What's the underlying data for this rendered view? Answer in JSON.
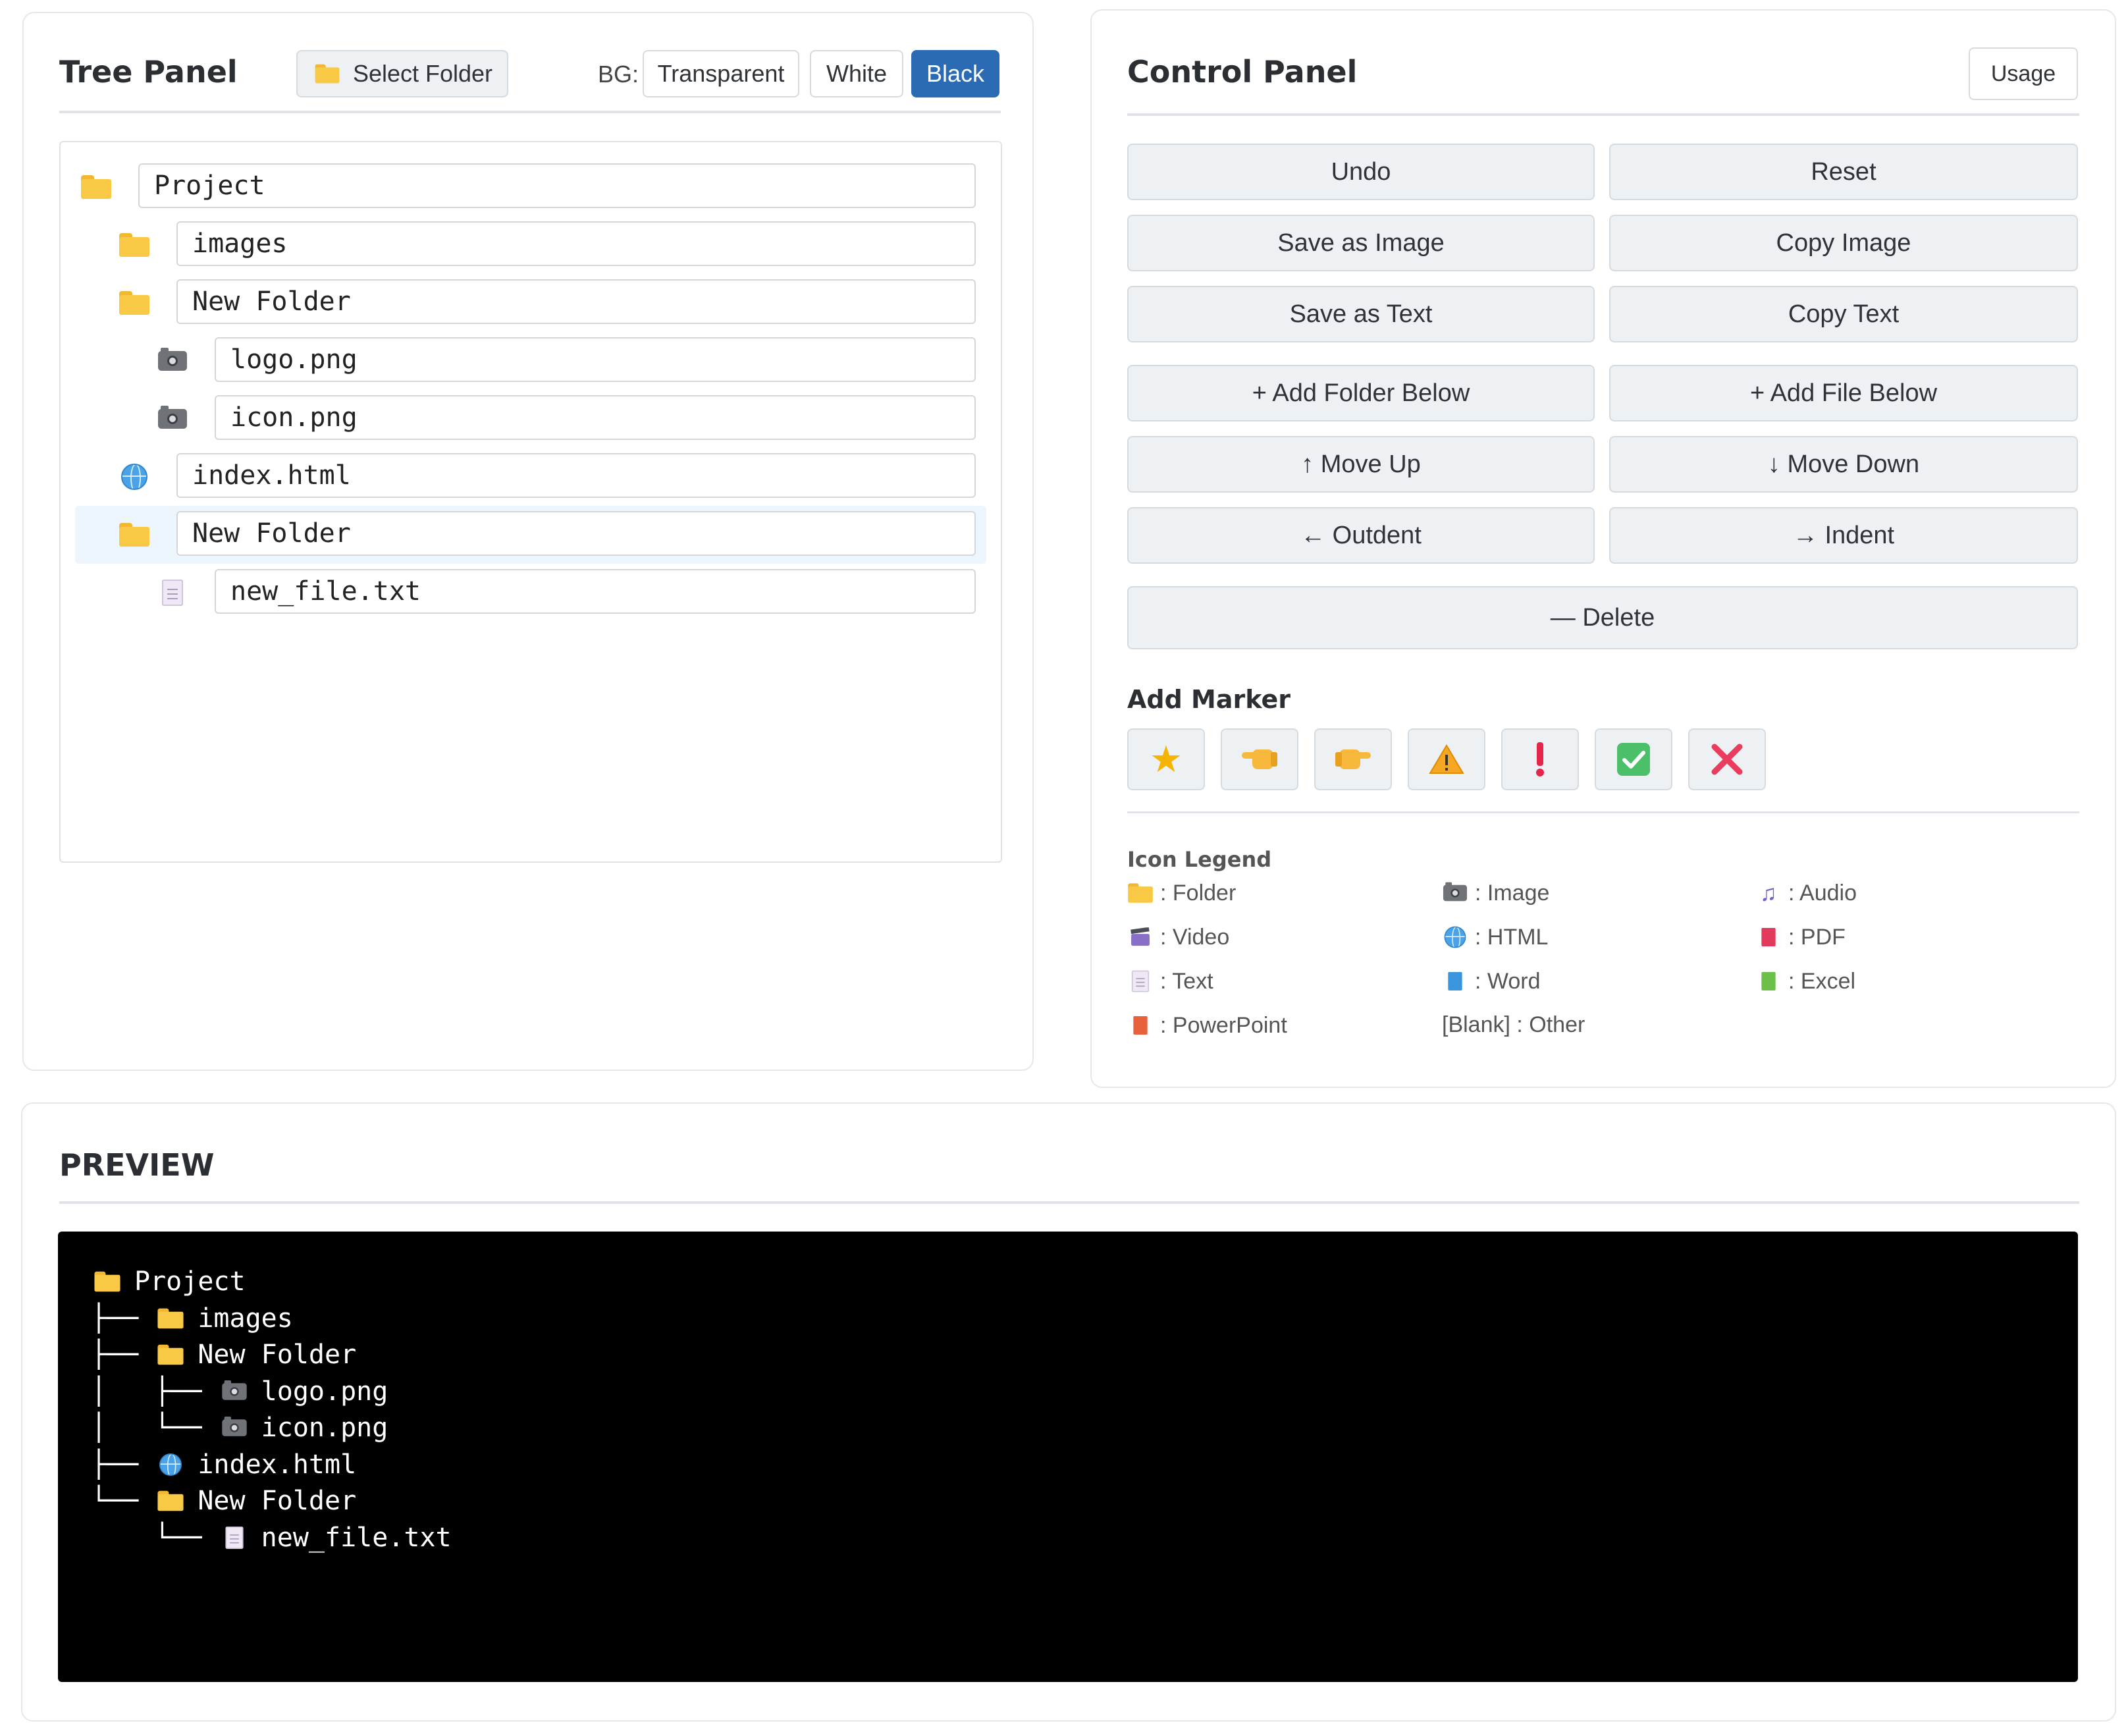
{
  "tree_panel": {
    "title": "Tree Panel",
    "select_folder_label": "Select Folder",
    "bg_label": "BG:",
    "bg_options": [
      "Transparent",
      "White",
      "Black"
    ],
    "bg_selected": "Black",
    "rows": [
      {
        "name": "Project",
        "icon": "folder-icon",
        "level": 0
      },
      {
        "name": "images",
        "icon": "folder-icon",
        "level": 1
      },
      {
        "name": "New Folder",
        "icon": "folder-icon",
        "level": 1
      },
      {
        "name": "logo.png",
        "icon": "camera-icon",
        "level": 2
      },
      {
        "name": "icon.png",
        "icon": "camera-icon",
        "level": 2
      },
      {
        "name": "index.html",
        "icon": "globe-icon",
        "level": 1
      },
      {
        "name": "New Folder",
        "icon": "folder-icon",
        "level": 1,
        "selected": true
      },
      {
        "name": "new_file.txt",
        "icon": "text-file-icon",
        "level": 2
      }
    ]
  },
  "control_panel": {
    "title": "Control Panel",
    "usage_label": "Usage",
    "buttons": {
      "undo": "Undo",
      "reset": "Reset",
      "save_image": "Save as Image",
      "copy_image": "Copy Image",
      "save_text": "Save as Text",
      "copy_text": "Copy Text",
      "add_folder": "+ Add Folder Below",
      "add_file": "+ Add File Below",
      "move_up": "↑ Move Up",
      "move_down": "↓ Move Down",
      "outdent": "← Outdent",
      "indent": "→ Indent",
      "delete": "— Delete"
    },
    "add_marker_title": "Add Marker",
    "markers": [
      "star-icon",
      "pointing-left-icon",
      "pointing-right-icon",
      "warning-icon",
      "exclamation-icon",
      "check-icon",
      "cross-icon"
    ],
    "legend_title": "Icon Legend",
    "legend": [
      {
        "icon": "folder-icon",
        "label": ": Folder"
      },
      {
        "icon": "camera-icon",
        "label": ": Image"
      },
      {
        "icon": "music-note-icon",
        "label": ": Audio"
      },
      {
        "icon": "clapper-icon",
        "label": ": Video"
      },
      {
        "icon": "globe-icon",
        "label": ": HTML"
      },
      {
        "icon": "pdf-book-icon",
        "label": ": PDF"
      },
      {
        "icon": "text-file-icon",
        "label": ": Text"
      },
      {
        "icon": "word-book-icon",
        "label": ": Word"
      },
      {
        "icon": "excel-book-icon",
        "label": ": Excel"
      },
      {
        "icon": "powerpoint-book-icon",
        "label": ": PowerPoint"
      },
      {
        "icon": "",
        "label": "[Blank] : Other"
      }
    ],
    "colors": {
      "pdf": "#e23a5a",
      "word": "#3a95de",
      "excel": "#6cc04a",
      "powerpoint": "#e8603c",
      "audio": "#7a5cc4",
      "video": "#8a6fc8"
    }
  },
  "preview": {
    "title": "PREVIEW",
    "lines": [
      {
        "prefix": "",
        "icon": "folder-icon",
        "name": "Project"
      },
      {
        "prefix": "├── ",
        "icon": "folder-icon",
        "name": "images"
      },
      {
        "prefix": "├── ",
        "icon": "folder-icon",
        "name": "New Folder"
      },
      {
        "prefix": "│   ├── ",
        "icon": "camera-icon",
        "name": "logo.png"
      },
      {
        "prefix": "│   └── ",
        "icon": "camera-icon",
        "name": "icon.png"
      },
      {
        "prefix": "├── ",
        "icon": "globe-icon",
        "name": "index.html"
      },
      {
        "prefix": "└── ",
        "icon": "folder-icon",
        "name": "New Folder"
      },
      {
        "prefix": "    └── ",
        "icon": "text-file-icon",
        "name": "new_file.txt"
      }
    ]
  },
  "accent_color": "#2a6bb3"
}
